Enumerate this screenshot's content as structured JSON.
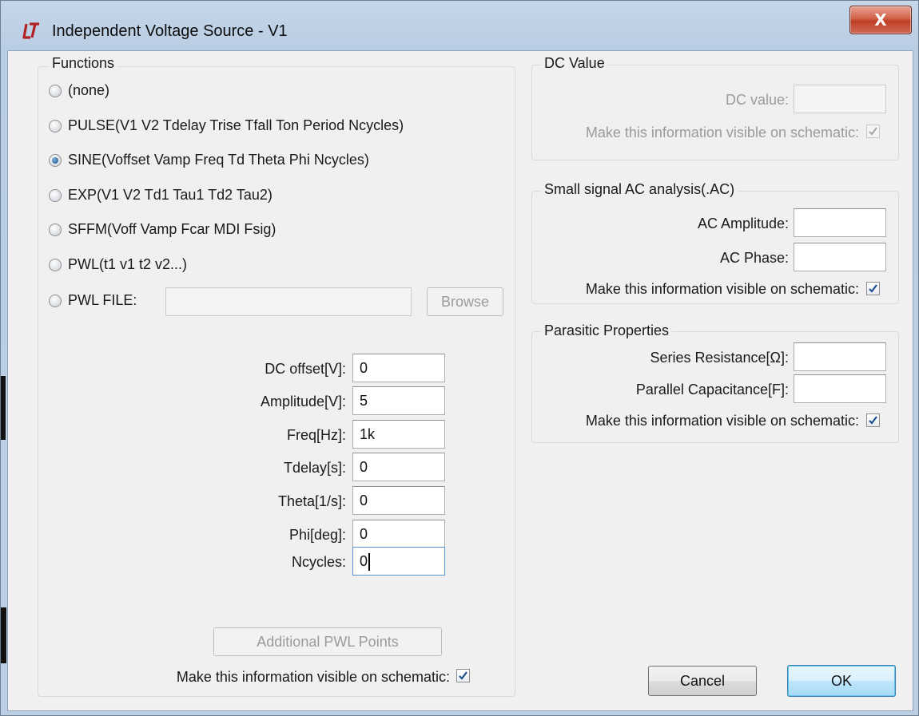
{
  "window": {
    "title": "Independent Voltage Source - V1",
    "close_glyph": "X"
  },
  "functions": {
    "label": "Functions",
    "options": [
      {
        "label": "(none)",
        "checked": false
      },
      {
        "label": "PULSE(V1 V2 Tdelay Trise Tfall Ton Period Ncycles)",
        "checked": false
      },
      {
        "label": "SINE(Voffset Vamp Freq Td Theta Phi Ncycles)",
        "checked": true
      },
      {
        "label": "EXP(V1 V2 Td1 Tau1 Td2 Tau2)",
        "checked": false
      },
      {
        "label": "SFFM(Voff Vamp Fcar MDI Fsig)",
        "checked": false
      },
      {
        "label": "PWL(t1 v1 t2 v2...)",
        "checked": false
      },
      {
        "label": "PWL FILE:",
        "checked": false
      }
    ],
    "pwl_file_value": "",
    "browse_label": "Browse",
    "params": [
      {
        "label": "DC offset[V]:",
        "value": "0"
      },
      {
        "label": "Amplitude[V]:",
        "value": "5"
      },
      {
        "label": "Freq[Hz]:",
        "value": "1k"
      },
      {
        "label": "Tdelay[s]:",
        "value": "0"
      },
      {
        "label": "Theta[1/s]:",
        "value": "0"
      },
      {
        "label": "Phi[deg]:",
        "value": "0"
      },
      {
        "label": "Ncycles:",
        "value": "0"
      }
    ],
    "additional_pwl_label": "Additional PWL Points",
    "visible_label": "Make this information visible on schematic:",
    "visible_checked": true
  },
  "dc_value": {
    "label": "DC Value",
    "field_label": "DC value:",
    "field_value": "",
    "visible_label": "Make this information visible on schematic:",
    "visible_checked": true
  },
  "ac": {
    "label": "Small signal AC analysis(.AC)",
    "amplitude_label": "AC Amplitude:",
    "amplitude_value": "",
    "phase_label": "AC Phase:",
    "phase_value": "",
    "visible_label": "Make this information visible on schematic:",
    "visible_checked": true
  },
  "parasitic": {
    "label": "Parasitic Properties",
    "resistance_label": "Series Resistance[Ω]:",
    "resistance_value": "",
    "capacitance_label": "Parallel Capacitance[F]:",
    "capacitance_value": "",
    "visible_label": "Make this information visible on schematic:",
    "visible_checked": true
  },
  "buttons": {
    "cancel": "Cancel",
    "ok": "OK"
  },
  "colors": {
    "accent": "#1d4f8c",
    "close_button": "#c03f26",
    "brand_logo": "#b22222"
  }
}
